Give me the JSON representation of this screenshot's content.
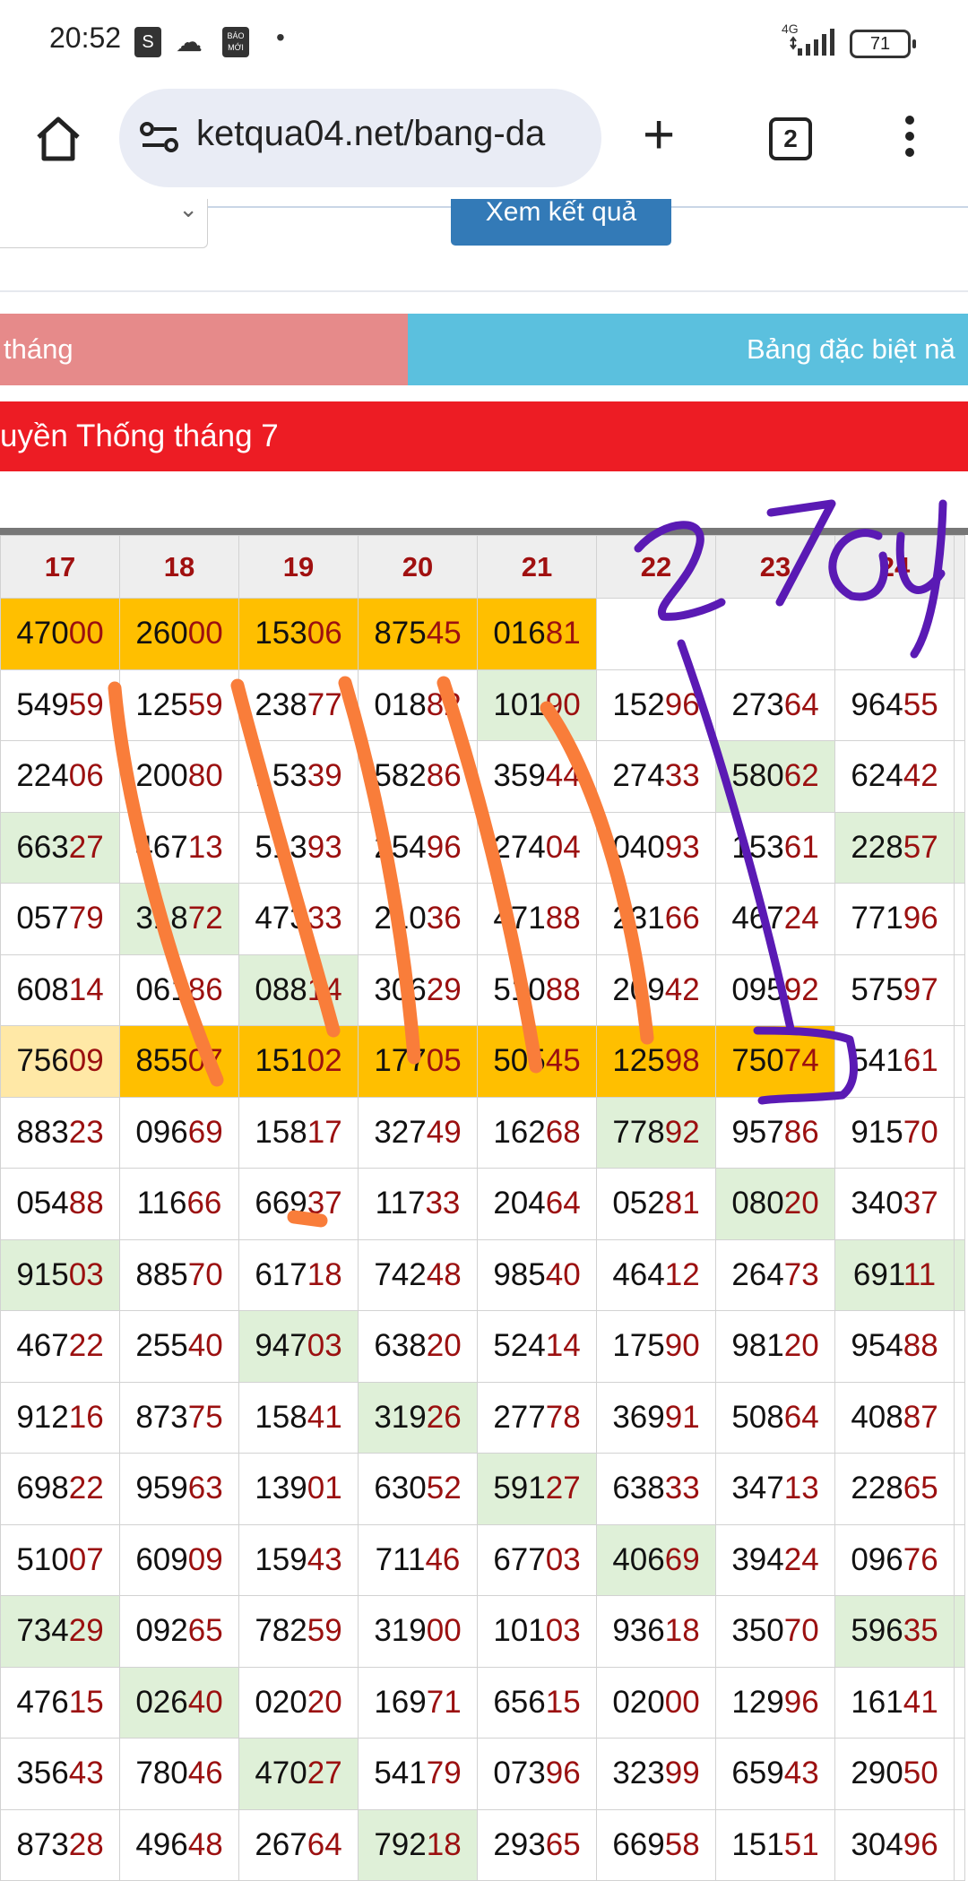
{
  "status_bar": {
    "time": "20:52",
    "notif_icons": [
      "shopping-bag-icon",
      "cloud-icon",
      "bao-moi-icon"
    ],
    "bao_moi_text": "BÁO MỚI",
    "network": "4G",
    "battery": "71"
  },
  "toolbar": {
    "url": "ketqua04.net/bang-da",
    "tab_count": "2"
  },
  "page": {
    "submit_label": "Xem kết quả",
    "tab_left": "tháng",
    "tab_right": "Bảng đặc biệt nă",
    "heading": "uyền Thống tháng 7"
  },
  "colors": {
    "highlight_orange": "#ffbf00",
    "highlight_light": "#ffe8a6",
    "green_cell": "#dff0d8",
    "tail_red": "#9b1010",
    "heading_red": "#ed1c24",
    "annotation_orange": "#f97d3a",
    "annotation_purple": "#5a1ab4"
  },
  "table": {
    "columns": [
      "17",
      "18",
      "19",
      "20",
      "21",
      "22",
      "23",
      "24"
    ],
    "rows": [
      [
        {
          "h": "470",
          "t": "00",
          "bg": "o"
        },
        {
          "h": "260",
          "t": "00",
          "bg": "o"
        },
        {
          "h": "153",
          "t": "06",
          "bg": "o"
        },
        {
          "h": "875",
          "t": "45",
          "bg": "o"
        },
        {
          "h": "016",
          "t": "81",
          "bg": "o"
        },
        {
          "h": "",
          "t": "",
          "bg": ""
        },
        {
          "h": "",
          "t": "",
          "bg": ""
        },
        {
          "h": "",
          "t": "",
          "bg": ""
        }
      ],
      [
        {
          "h": "549",
          "t": "59",
          "bg": ""
        },
        {
          "h": "125",
          "t": "59",
          "bg": ""
        },
        {
          "h": "238",
          "t": "77",
          "bg": ""
        },
        {
          "h": "018",
          "t": "82",
          "bg": ""
        },
        {
          "h": "101",
          "t": "90",
          "bg": "g"
        },
        {
          "h": "152",
          "t": "96",
          "bg": ""
        },
        {
          "h": "273",
          "t": "64",
          "bg": ""
        },
        {
          "h": "964",
          "t": "55",
          "bg": ""
        }
      ],
      [
        {
          "h": "224",
          "t": "06",
          "bg": ""
        },
        {
          "h": "200",
          "t": "80",
          "bg": ""
        },
        {
          "h": "153",
          "t": "39",
          "bg": ""
        },
        {
          "h": "582",
          "t": "86",
          "bg": ""
        },
        {
          "h": "359",
          "t": "44",
          "bg": ""
        },
        {
          "h": "274",
          "t": "33",
          "bg": ""
        },
        {
          "h": "580",
          "t": "62",
          "bg": "g"
        },
        {
          "h": "624",
          "t": "42",
          "bg": ""
        }
      ],
      [
        {
          "h": "663",
          "t": "27",
          "bg": "g"
        },
        {
          "h": "467",
          "t": "13",
          "bg": ""
        },
        {
          "h": "513",
          "t": "93",
          "bg": ""
        },
        {
          "h": "254",
          "t": "96",
          "bg": ""
        },
        {
          "h": "274",
          "t": "04",
          "bg": ""
        },
        {
          "h": "040",
          "t": "93",
          "bg": ""
        },
        {
          "h": "153",
          "t": "61",
          "bg": ""
        },
        {
          "h": "228",
          "t": "57",
          "bg": "g"
        }
      ],
      [
        {
          "h": "057",
          "t": "79",
          "bg": ""
        },
        {
          "h": "318",
          "t": "72",
          "bg": "g"
        },
        {
          "h": "473",
          "t": "33",
          "bg": ""
        },
        {
          "h": "210",
          "t": "36",
          "bg": ""
        },
        {
          "h": "471",
          "t": "88",
          "bg": ""
        },
        {
          "h": "231",
          "t": "66",
          "bg": ""
        },
        {
          "h": "467",
          "t": "24",
          "bg": ""
        },
        {
          "h": "771",
          "t": "96",
          "bg": ""
        }
      ],
      [
        {
          "h": "608",
          "t": "14",
          "bg": ""
        },
        {
          "h": "061",
          "t": "86",
          "bg": ""
        },
        {
          "h": "088",
          "t": "14",
          "bg": "g"
        },
        {
          "h": "306",
          "t": "29",
          "bg": ""
        },
        {
          "h": "510",
          "t": "88",
          "bg": ""
        },
        {
          "h": "209",
          "t": "42",
          "bg": ""
        },
        {
          "h": "095",
          "t": "92",
          "bg": ""
        },
        {
          "h": "575",
          "t": "97",
          "bg": ""
        }
      ],
      [
        {
          "h": "756",
          "t": "09",
          "bg": "y"
        },
        {
          "h": "855",
          "t": "07",
          "bg": "o"
        },
        {
          "h": "151",
          "t": "02",
          "bg": "o"
        },
        {
          "h": "177",
          "t": "05",
          "bg": "o"
        },
        {
          "h": "505",
          "t": "45",
          "bg": "o"
        },
        {
          "h": "125",
          "t": "98",
          "bg": "o"
        },
        {
          "h": "750",
          "t": "74",
          "bg": "o"
        },
        {
          "h": "541",
          "t": "61",
          "bg": ""
        }
      ],
      [
        {
          "h": "883",
          "t": "23",
          "bg": ""
        },
        {
          "h": "096",
          "t": "69",
          "bg": ""
        },
        {
          "h": "158",
          "t": "17",
          "bg": ""
        },
        {
          "h": "327",
          "t": "49",
          "bg": ""
        },
        {
          "h": "162",
          "t": "68",
          "bg": ""
        },
        {
          "h": "778",
          "t": "92",
          "bg": "g"
        },
        {
          "h": "957",
          "t": "86",
          "bg": ""
        },
        {
          "h": "915",
          "t": "70",
          "bg": ""
        }
      ],
      [
        {
          "h": "054",
          "t": "88",
          "bg": ""
        },
        {
          "h": "116",
          "t": "66",
          "bg": ""
        },
        {
          "h": "669",
          "t": "37",
          "bg": ""
        },
        {
          "h": "117",
          "t": "33",
          "bg": ""
        },
        {
          "h": "204",
          "t": "64",
          "bg": ""
        },
        {
          "h": "052",
          "t": "81",
          "bg": ""
        },
        {
          "h": "080",
          "t": "20",
          "bg": "g"
        },
        {
          "h": "340",
          "t": "37",
          "bg": ""
        }
      ],
      [
        {
          "h": "915",
          "t": "03",
          "bg": "g"
        },
        {
          "h": "885",
          "t": "70",
          "bg": ""
        },
        {
          "h": "617",
          "t": "18",
          "bg": ""
        },
        {
          "h": "742",
          "t": "48",
          "bg": ""
        },
        {
          "h": "985",
          "t": "40",
          "bg": ""
        },
        {
          "h": "464",
          "t": "12",
          "bg": ""
        },
        {
          "h": "264",
          "t": "73",
          "bg": ""
        },
        {
          "h": "691",
          "t": "11",
          "bg": "g"
        }
      ],
      [
        {
          "h": "467",
          "t": "22",
          "bg": ""
        },
        {
          "h": "255",
          "t": "40",
          "bg": ""
        },
        {
          "h": "947",
          "t": "03",
          "bg": "g"
        },
        {
          "h": "638",
          "t": "20",
          "bg": ""
        },
        {
          "h": "524",
          "t": "14",
          "bg": ""
        },
        {
          "h": "175",
          "t": "90",
          "bg": ""
        },
        {
          "h": "981",
          "t": "20",
          "bg": ""
        },
        {
          "h": "954",
          "t": "88",
          "bg": ""
        }
      ],
      [
        {
          "h": "912",
          "t": "16",
          "bg": ""
        },
        {
          "h": "873",
          "t": "75",
          "bg": ""
        },
        {
          "h": "158",
          "t": "41",
          "bg": ""
        },
        {
          "h": "319",
          "t": "26",
          "bg": "g"
        },
        {
          "h": "277",
          "t": "78",
          "bg": ""
        },
        {
          "h": "369",
          "t": "91",
          "bg": ""
        },
        {
          "h": "508",
          "t": "64",
          "bg": ""
        },
        {
          "h": "408",
          "t": "87",
          "bg": ""
        }
      ],
      [
        {
          "h": "698",
          "t": "22",
          "bg": ""
        },
        {
          "h": "959",
          "t": "63",
          "bg": ""
        },
        {
          "h": "139",
          "t": "01",
          "bg": ""
        },
        {
          "h": "630",
          "t": "52",
          "bg": ""
        },
        {
          "h": "591",
          "t": "27",
          "bg": "g"
        },
        {
          "h": "638",
          "t": "33",
          "bg": ""
        },
        {
          "h": "347",
          "t": "13",
          "bg": ""
        },
        {
          "h": "228",
          "t": "65",
          "bg": ""
        }
      ],
      [
        {
          "h": "510",
          "t": "07",
          "bg": ""
        },
        {
          "h": "609",
          "t": "09",
          "bg": ""
        },
        {
          "h": "159",
          "t": "43",
          "bg": ""
        },
        {
          "h": "711",
          "t": "46",
          "bg": ""
        },
        {
          "h": "677",
          "t": "03",
          "bg": ""
        },
        {
          "h": "406",
          "t": "69",
          "bg": "g"
        },
        {
          "h": "394",
          "t": "24",
          "bg": ""
        },
        {
          "h": "096",
          "t": "76",
          "bg": ""
        }
      ],
      [
        {
          "h": "734",
          "t": "29",
          "bg": "g"
        },
        {
          "h": "092",
          "t": "65",
          "bg": ""
        },
        {
          "h": "782",
          "t": "59",
          "bg": ""
        },
        {
          "h": "319",
          "t": "00",
          "bg": ""
        },
        {
          "h": "101",
          "t": "03",
          "bg": ""
        },
        {
          "h": "936",
          "t": "18",
          "bg": ""
        },
        {
          "h": "350",
          "t": "70",
          "bg": ""
        },
        {
          "h": "596",
          "t": "35",
          "bg": "g"
        }
      ],
      [
        {
          "h": "476",
          "t": "15",
          "bg": ""
        },
        {
          "h": "026",
          "t": "40",
          "bg": "g"
        },
        {
          "h": "020",
          "t": "20",
          "bg": ""
        },
        {
          "h": "169",
          "t": "71",
          "bg": ""
        },
        {
          "h": "656",
          "t": "15",
          "bg": ""
        },
        {
          "h": "020",
          "t": "00",
          "bg": ""
        },
        {
          "h": "129",
          "t": "96",
          "bg": ""
        },
        {
          "h": "161",
          "t": "41",
          "bg": ""
        }
      ],
      [
        {
          "h": "356",
          "t": "43",
          "bg": ""
        },
        {
          "h": "780",
          "t": "46",
          "bg": ""
        },
        {
          "h": "470",
          "t": "27",
          "bg": "g"
        },
        {
          "h": "541",
          "t": "79",
          "bg": ""
        },
        {
          "h": "073",
          "t": "96",
          "bg": ""
        },
        {
          "h": "323",
          "t": "99",
          "bg": ""
        },
        {
          "h": "659",
          "t": "43",
          "bg": ""
        },
        {
          "h": "290",
          "t": "50",
          "bg": ""
        }
      ],
      [
        {
          "h": "873",
          "t": "28",
          "bg": ""
        },
        {
          "h": "496",
          "t": "48",
          "bg": ""
        },
        {
          "h": "267",
          "t": "64",
          "bg": ""
        },
        {
          "h": "792",
          "t": "18",
          "bg": "g"
        },
        {
          "h": "293",
          "t": "65",
          "bg": ""
        },
        {
          "h": "669",
          "t": "58",
          "bg": ""
        },
        {
          "h": "151",
          "t": "51",
          "bg": ""
        },
        {
          "h": "304",
          "t": "96",
          "bg": ""
        }
      ]
    ]
  },
  "annotation": {
    "handwritten_text": "27cy"
  }
}
